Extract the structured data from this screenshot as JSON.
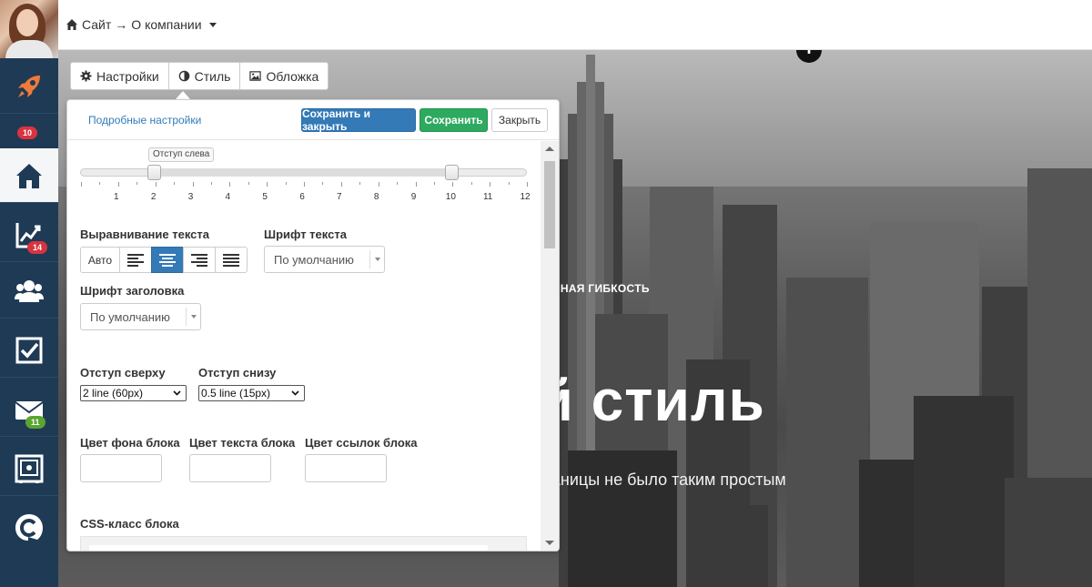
{
  "sidebar": {
    "items": [
      {
        "name": "rocket",
        "icon": "rocket-icon",
        "badge": ""
      },
      {
        "name": "home",
        "icon": "home-icon",
        "badge": "10",
        "badge_color": "#d9333f"
      },
      {
        "name": "stats",
        "icon": "chart-icon",
        "badge": "14",
        "badge_color": "#d9333f"
      },
      {
        "name": "users",
        "icon": "users-icon",
        "badge": ""
      },
      {
        "name": "tasks",
        "icon": "checkbox-icon",
        "badge": ""
      },
      {
        "name": "mail",
        "icon": "mail-icon",
        "badge": "11",
        "badge_color": "#5aa432"
      },
      {
        "name": "safe",
        "icon": "safe-icon",
        "badge": ""
      },
      {
        "name": "brand",
        "icon": "c-logo-icon",
        "badge": ""
      }
    ]
  },
  "topbar": {
    "breadcrumb_site": "Сайт",
    "breadcrumb_arrow": "→",
    "breadcrumb_page": "О компании"
  },
  "tabs": [
    {
      "label": "Настройки",
      "icon": "gear-icon"
    },
    {
      "label": "Стиль",
      "icon": "contrast-icon",
      "active": true
    },
    {
      "label": "Обложка",
      "icon": "image-icon"
    }
  ],
  "panel": {
    "advanced_link": "Подробные настройки",
    "save_close_label": "Сохранить и закрыть",
    "save_label": "Сохранить",
    "close_label": "Закрыть",
    "slider": {
      "tooltip": "Отступ слева",
      "min": 1,
      "max": 12,
      "value_low": 2,
      "value_high": 10,
      "tick_labels": [
        "1",
        "2",
        "3",
        "4",
        "5",
        "6",
        "7",
        "8",
        "9",
        "10",
        "11",
        "12"
      ]
    },
    "text_align_label": "Выравнивание текста",
    "align_auto_label": "Авто",
    "align_active": "center",
    "font_text_label": "Шрифт текста",
    "font_text_value": "По умолчанию",
    "font_heading_label": "Шрифт заголовка",
    "font_heading_value": "По умолчанию",
    "padding_top_label": "Отступ сверху",
    "padding_top_value": "2 line (60px)",
    "padding_bottom_label": "Отступ снизу",
    "padding_bottom_value": "0.5 line (15px)",
    "bg_color_label": "Цвет фона блока",
    "text_color_label": "Цвет текста блока",
    "link_color_label": "Цвет ссылок блока",
    "css_class_label": "CSS-класс блока"
  },
  "hero": {
    "kicker": "МАКСИМАЛЬНАЯ ГИБКОСТЬ",
    "title": "Новый стиль",
    "subtitle": "Никогда еще создание страницы не было таким простым",
    "add_icon": "plus-icon"
  },
  "colors": {
    "sidebar_bg": "#1f3a55",
    "primary": "#337ab7",
    "success": "#2daa5f",
    "badge_red": "#d9333f",
    "badge_green": "#5aa432",
    "rocket": "#ef7a3a"
  }
}
